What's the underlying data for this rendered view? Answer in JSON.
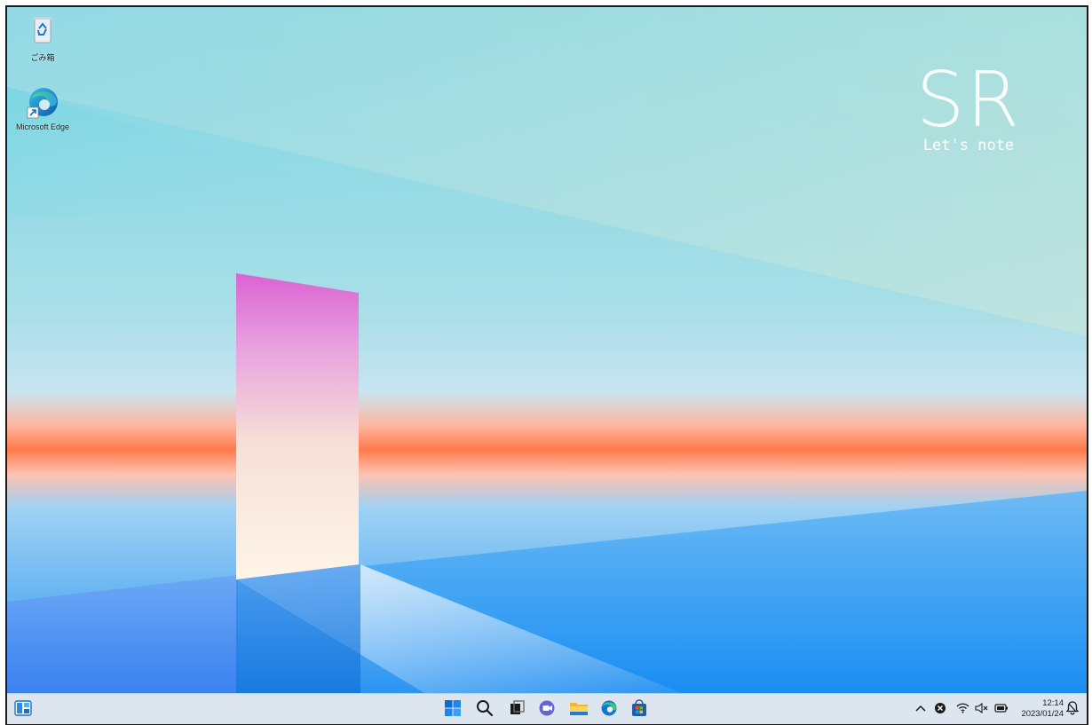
{
  "desktop": {
    "icons": [
      {
        "label": "ごみ箱",
        "icon": "recycle-bin-icon"
      },
      {
        "label": "Microsoft Edge",
        "icon": "edge-icon"
      }
    ]
  },
  "brand": {
    "title": "SR",
    "subtitle": "Let's note"
  },
  "taskbar": {
    "widgets_icon": "widgets-icon",
    "apps": [
      {
        "name": "Start",
        "icon": "windows-start-icon"
      },
      {
        "name": "Search",
        "icon": "search-icon"
      },
      {
        "name": "Task View",
        "icon": "task-view-icon"
      },
      {
        "name": "Chat",
        "icon": "chat-icon"
      },
      {
        "name": "File Explorer",
        "icon": "folder-icon"
      },
      {
        "name": "Microsoft Edge",
        "icon": "edge-icon"
      },
      {
        "name": "Microsoft Store",
        "icon": "store-icon"
      }
    ],
    "tray": {
      "icons": [
        "chevron-up-icon",
        "status-x-icon",
        "wifi-icon",
        "volume-muted-icon",
        "battery-icon",
        "notification-bell-icon"
      ]
    },
    "clock": {
      "time": "12:14",
      "date": "2023/01/24"
    }
  },
  "colors": {
    "accent": "#0067c0",
    "taskbar_bg": "#dde6ef",
    "sky_top": "#7fd6e3",
    "horizon_orange": "#ff7a4a",
    "floor_blue": "#1a8ff0"
  }
}
